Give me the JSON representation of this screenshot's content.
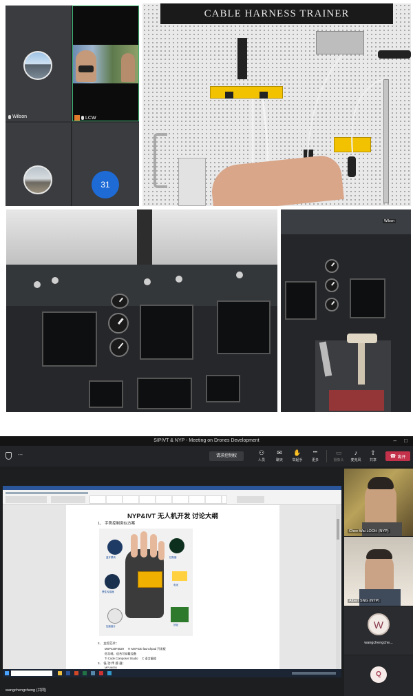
{
  "collage": {
    "participants": [
      {
        "name": "Wilson"
      },
      {
        "name": "LCW"
      }
    ],
    "participant_count_badge": "31",
    "trainer_sign": "CABLE HARNESS TRAINER",
    "cockpit_right_tag": "Wilson"
  },
  "meeting": {
    "window_title": "SIPIVT & NYP - Meeting on Drones Development",
    "window_controls": {
      "minimize": "–",
      "maximize": "□"
    },
    "meeting_id": "---",
    "request_control": "请求控制权",
    "toolbar": [
      {
        "label": "人员",
        "icon": "people-icon",
        "glyph": "⚇"
      },
      {
        "label": "聊天",
        "icon": "chat-icon",
        "glyph": "✉"
      },
      {
        "label": "举起手",
        "icon": "raise-hand-icon",
        "glyph": "✋"
      },
      {
        "label": "更多",
        "icon": "more-icon",
        "glyph": "•••"
      },
      {
        "label": "摄像头",
        "icon": "camera-icon",
        "glyph": "▭"
      },
      {
        "label": "麦克风",
        "icon": "mic-icon",
        "glyph": "♪"
      },
      {
        "label": "共享",
        "icon": "share-icon",
        "glyph": "⇪"
      }
    ],
    "leave_button": "离开",
    "document": {
      "title": "NYP&IVT 无人机开发 讨论大纲",
      "item1": "1、 手势控制类似方案",
      "item2": "2、 主控芯片：",
      "item2_line1": "MSP430F5529     TI MSP430 launchpad 开发板",
      "item2_line2": "低功耗，适合可穿戴设备",
      "item2_line3": "TI Code Composer Studio     C 语言编程",
      "item3": "3、 低 功 传 感 器：",
      "item3_line1": "MPU6050",
      "figure_labels": [
        "蓝牙模块",
        "控制器",
        "惯性传感器",
        "电池",
        "加速度计",
        "按钮"
      ]
    },
    "presenter": "wangchengcheng (共同)",
    "videos": [
      {
        "name": "Chee Wai LOOH (NYP)"
      },
      {
        "name": "Albert SNG (NYP)"
      },
      {
        "name": "wangchengche...",
        "initial": "W"
      },
      {
        "initial": "Q"
      }
    ]
  }
}
